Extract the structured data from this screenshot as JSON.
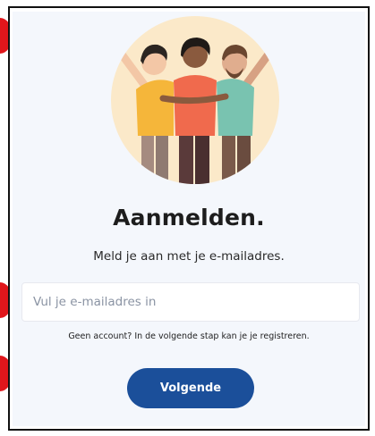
{
  "login": {
    "title": "Aanmelden.",
    "subtitle": "Meld je aan met je e-mailadres.",
    "email_placeholder": "Vul je e-mailadres in",
    "email_value": "",
    "hint": "Geen account? In de volgende stap kan je je registreren.",
    "next_label": "Volgende"
  },
  "illustration": {
    "icon": "friends-group-illustration",
    "colors": {
      "circle": "#fbe9c9",
      "left_shirt": "#f5b63a",
      "middle_shirt": "#f06a4d",
      "right_shirt": "#79c3b0",
      "button": "#1b4f9a"
    }
  }
}
